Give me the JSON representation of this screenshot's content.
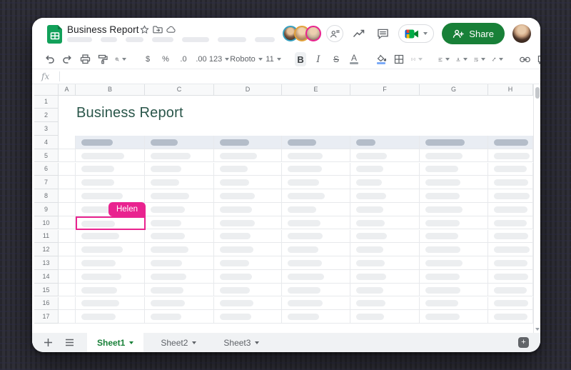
{
  "titlebar": {
    "title": "Business Report",
    "icons": [
      "star-icon",
      "move-folder-icon",
      "cloud-saved-icon"
    ],
    "menu_pill_widths": [
      35,
      23,
      25,
      30,
      38,
      40,
      28
    ]
  },
  "header": {
    "share_label": "Share",
    "collaborator_rings": [
      "#35a0c0",
      "#e2a23b",
      "#e9238f"
    ],
    "collaborator_faces": [
      "face1",
      "face2",
      "face3"
    ]
  },
  "toolbar": {
    "currency": "$",
    "percent": "%",
    "dec_decrease": ".0",
    "dec_increase": ".00",
    "number_format": "123",
    "font_name": "Roboto",
    "font_size": "11",
    "bold": "B",
    "italic": "I",
    "strikethrough": "S",
    "text_color": "A",
    "accent_underline": "#7baaf7",
    "text_underline": "#9aa0a6"
  },
  "formula_bar": {
    "fx_label": "fx",
    "value": ""
  },
  "grid": {
    "column_letters": [
      "A",
      "B",
      "C",
      "D",
      "E",
      "F",
      "G",
      "H"
    ],
    "row_count": 17,
    "title_text": "Business Report",
    "title_color": "#2a564a",
    "band_row": 4,
    "band_color": "#e9edf3",
    "band_pill_color": "#b4bdc9",
    "pill_color": "#eceef0",
    "band_pill_widths": [
      46,
      40,
      44,
      42,
      28,
      58,
      78
    ],
    "pill_widths": [
      [
        62,
        58,
        55,
        52,
        45,
        55,
        80
      ],
      [
        48,
        45,
        42,
        50,
        40,
        48,
        74
      ],
      [
        48,
        42,
        44,
        46,
        38,
        52,
        78
      ],
      [
        60,
        56,
        52,
        55,
        44,
        50,
        80
      ],
      [
        45,
        50,
        48,
        42,
        40,
        55,
        76
      ],
      [
        50,
        45,
        52,
        48,
        42,
        50,
        74
      ],
      [
        55,
        50,
        46,
        52,
        45,
        48,
        78
      ],
      [
        60,
        55,
        50,
        45,
        40,
        52,
        80
      ],
      [
        50,
        46,
        44,
        50,
        42,
        55,
        76
      ],
      [
        58,
        52,
        48,
        54,
        44,
        50,
        78
      ],
      [
        52,
        48,
        45,
        48,
        40,
        52,
        74
      ],
      [
        55,
        50,
        50,
        52,
        43,
        48,
        78
      ],
      [
        50,
        45,
        47,
        46,
        41,
        50,
        76
      ]
    ],
    "selection": {
      "row": 10,
      "col": "B",
      "label": "Helen",
      "color": "#e9238f"
    }
  },
  "tabs": {
    "items": [
      {
        "label": "Sheet1",
        "active": true
      },
      {
        "label": "Sheet2",
        "active": false
      },
      {
        "label": "Sheet3",
        "active": false
      }
    ]
  }
}
